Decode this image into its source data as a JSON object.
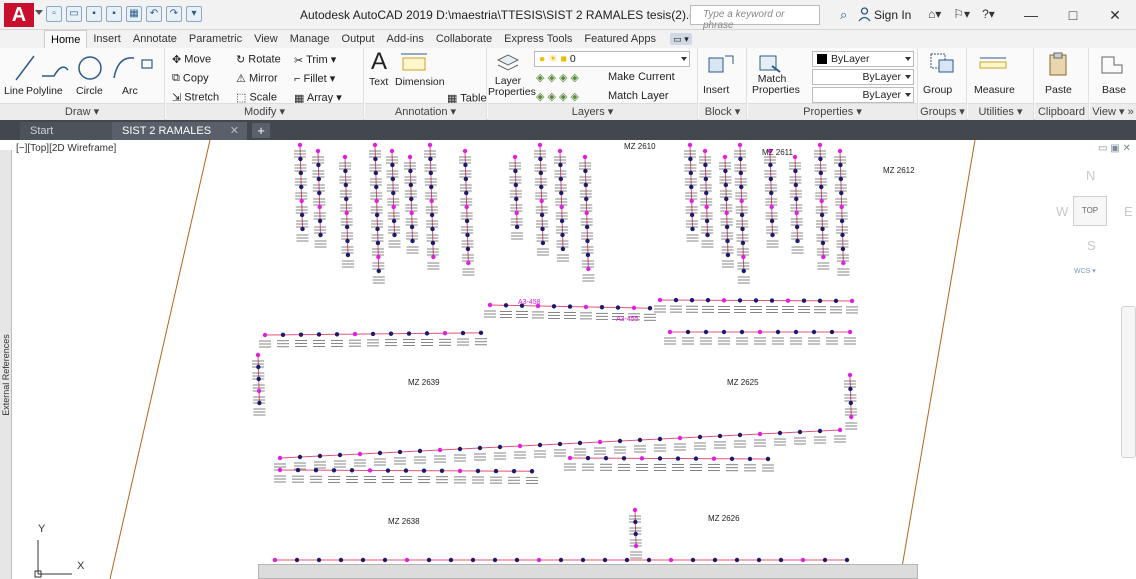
{
  "app": {
    "logo": "A",
    "title": "Autodesk AutoCAD 2019   D:\\maestria\\TTESIS\\SIST 2 RAMALES tesis(2).dwg",
    "search_placeholder": "Type a keyword or phrase",
    "sign_in": "Sign In",
    "window_controls": [
      "—",
      "□",
      "✕"
    ]
  },
  "tabs": [
    "Home",
    "Insert",
    "Annotate",
    "Parametric",
    "View",
    "Manage",
    "Output",
    "Add-ins",
    "Collaborate",
    "Express Tools",
    "Featured Apps"
  ],
  "tab_extra": "▭ ▾",
  "ribbon": {
    "draw": {
      "title": "Draw ▾",
      "tools": [
        "Line",
        "Polyline",
        "Circle",
        "Arc"
      ]
    },
    "modify": {
      "title": "Modify ▾",
      "tools": [
        "Move",
        "Rotate",
        "Trim ▾",
        "Copy",
        "Mirror",
        "Fillet ▾",
        "Stretch",
        "Scale",
        "Array ▾"
      ]
    },
    "annotation": {
      "title": "Annotation ▾",
      "tools": [
        "Text",
        "Dimension",
        "Table"
      ]
    },
    "layers": {
      "title": "Layers ▾",
      "layer_properties": "Layer\nProperties",
      "current_layer": "0",
      "make_current": "Make Current",
      "match_layer": "Match Layer"
    },
    "block": {
      "title": "Block ▾",
      "insert": "Insert"
    },
    "properties": {
      "title": "Properties ▾",
      "match_properties": "Match\nProperties",
      "color": "ByLayer",
      "linetype": "ByLayer",
      "lineweight": "ByLayer"
    },
    "groups": {
      "title": "Groups ▾",
      "group": "Group"
    },
    "utilities": {
      "title": "Utilities ▾",
      "measure": "Measure"
    },
    "clipboard": {
      "title": "Clipboard",
      "paste": "Paste"
    },
    "view": {
      "title": "View ▾ »",
      "base": "Base"
    }
  },
  "file_tabs": {
    "start": "Start",
    "active": "SIST 2 RAMALES tesis(2)*",
    "close": "✕",
    "new": "+"
  },
  "drawing": {
    "viewport_label": "[−][Top][2D Wireframe]",
    "external_references": "External References",
    "block_labels": [
      "MZ 2610",
      "MZ 2611",
      "MZ 2612",
      "MZ 2639",
      "MZ 2625",
      "MZ 2638",
      "MZ 2626"
    ],
    "node_labels": [
      "A3-458",
      "A3-455"
    ],
    "viewcube": {
      "north": "N",
      "south": "S",
      "east": "E",
      "west": "W",
      "top": "TOP",
      "wcs": "WCS ▾"
    },
    "ucs": {
      "y": "Y",
      "x": "X"
    }
  },
  "colors": {
    "accent_red": "#c8102e",
    "pipe_line": "#e8507a",
    "node_magenta": "#e020e0",
    "node_navy": "#1a1a6e",
    "parcel_line": "#b5651d"
  }
}
